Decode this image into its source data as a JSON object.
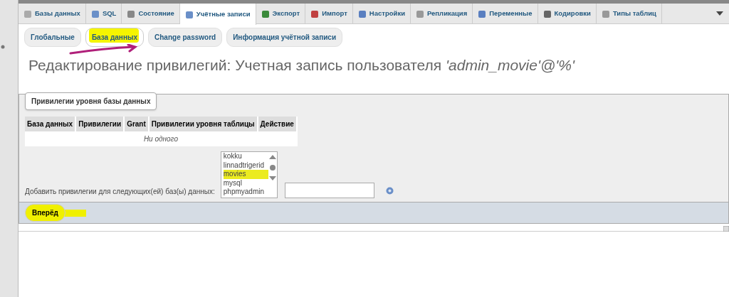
{
  "top_tabs": [
    {
      "label": "Базы данных",
      "selected": false
    },
    {
      "label": "SQL",
      "selected": false
    },
    {
      "label": "Состояние",
      "selected": false
    },
    {
      "label": "Учётные записи",
      "selected": true
    },
    {
      "label": "Экспорт",
      "selected": false
    },
    {
      "label": "Импорт",
      "selected": false
    },
    {
      "label": "Настройки",
      "selected": false
    },
    {
      "label": "Репликация",
      "selected": false
    },
    {
      "label": "Переменные",
      "selected": false
    },
    {
      "label": "Кодировки",
      "selected": false
    },
    {
      "label": "Типы таблиц",
      "selected": false
    }
  ],
  "sub_tabs": [
    {
      "label": "Глобальные",
      "selected": false
    },
    {
      "label": "База данных",
      "selected": true
    },
    {
      "label": "Change password",
      "selected": false
    },
    {
      "label": "Информация учётной записи",
      "selected": false
    }
  ],
  "heading": "Редактирование привилегий: Учетная запись пользователя *'admin_movie'@'%'*",
  "fieldset": {
    "legend": "Привилегии уровня базы данных",
    "table": {
      "columns": [
        "База данных",
        "Привилегии",
        "Grant",
        "Привилегии уровня таблицы",
        "Действие"
      ],
      "empty_text": "Ни одного"
    },
    "add_label": "Добавить привилегии для следующих(ей) баз(ы) данных:",
    "databases": [
      {
        "name": "kokku",
        "selected": false
      },
      {
        "name": "linnadtrigerid",
        "selected": false
      },
      {
        "name": "movies",
        "selected": true
      },
      {
        "name": "mysql",
        "selected": false
      },
      {
        "name": "phpmyadmin",
        "selected": false
      }
    ]
  },
  "submit_button": "Вперёд"
}
